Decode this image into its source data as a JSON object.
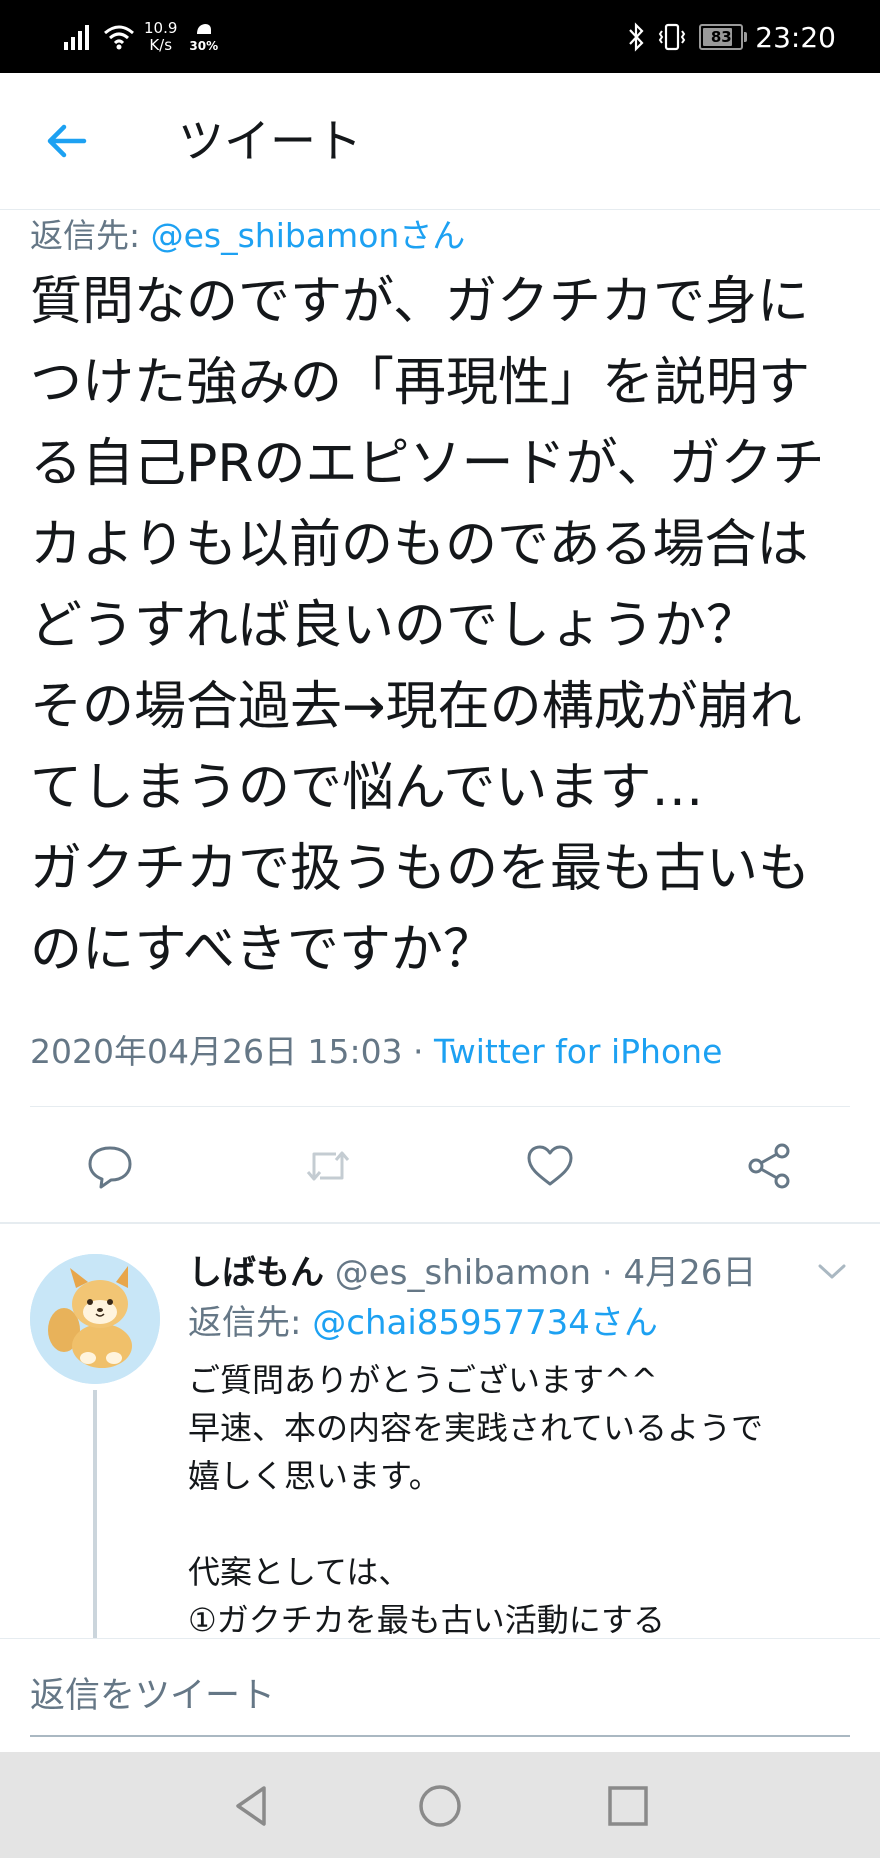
{
  "status_bar": {
    "net_speed_value": "10.9",
    "net_speed_unit": "K/s",
    "data_saver": "30%",
    "battery": "83",
    "battery_level": 0.83,
    "time": "23:20"
  },
  "header": {
    "title": "ツイート"
  },
  "tweet": {
    "reply_to_label": "返信先: ",
    "reply_to_handle": "@es_shibamonさん",
    "text_lines": [
      "質問なのですが、ガクチカで身に",
      "つけた強みの「再現性」を説明す",
      "る自己PRのエピソードが、ガクチ",
      "カよりも以前のものである場合は",
      "どうすれば良いのでしょうか？",
      "その場合過去→現在の構成が崩れ",
      "てしまうので悩んでいます…",
      "ガクチカで扱うものを最も古いも",
      "のにすべきですか？"
    ],
    "datetime": "2020年04月26日 15:03 · ",
    "source": "Twitter for iPhone"
  },
  "actions": {
    "reply": "reply-icon",
    "retweet": "retweet-icon",
    "like": "heart-icon",
    "share": "share-icon"
  },
  "reply": {
    "name": "しばもん",
    "handle_and_date": " @es_shibamon · 4月26日",
    "reply_to_label": "返信先: ",
    "reply_to_handle": "@chai85957734さん",
    "body_lines": [
      "ご質問ありがとうございます^^",
      "早速、本の内容を実践されているようで",
      "嬉しく思います。",
      "",
      "代案としては、",
      "①ガクチカを最も古い活動にする"
    ]
  },
  "compose": {
    "placeholder": "返信をツイート"
  },
  "colors": {
    "accent": "#1da1f2",
    "secondary_text": "#657786",
    "divider": "#e6ecf0"
  }
}
